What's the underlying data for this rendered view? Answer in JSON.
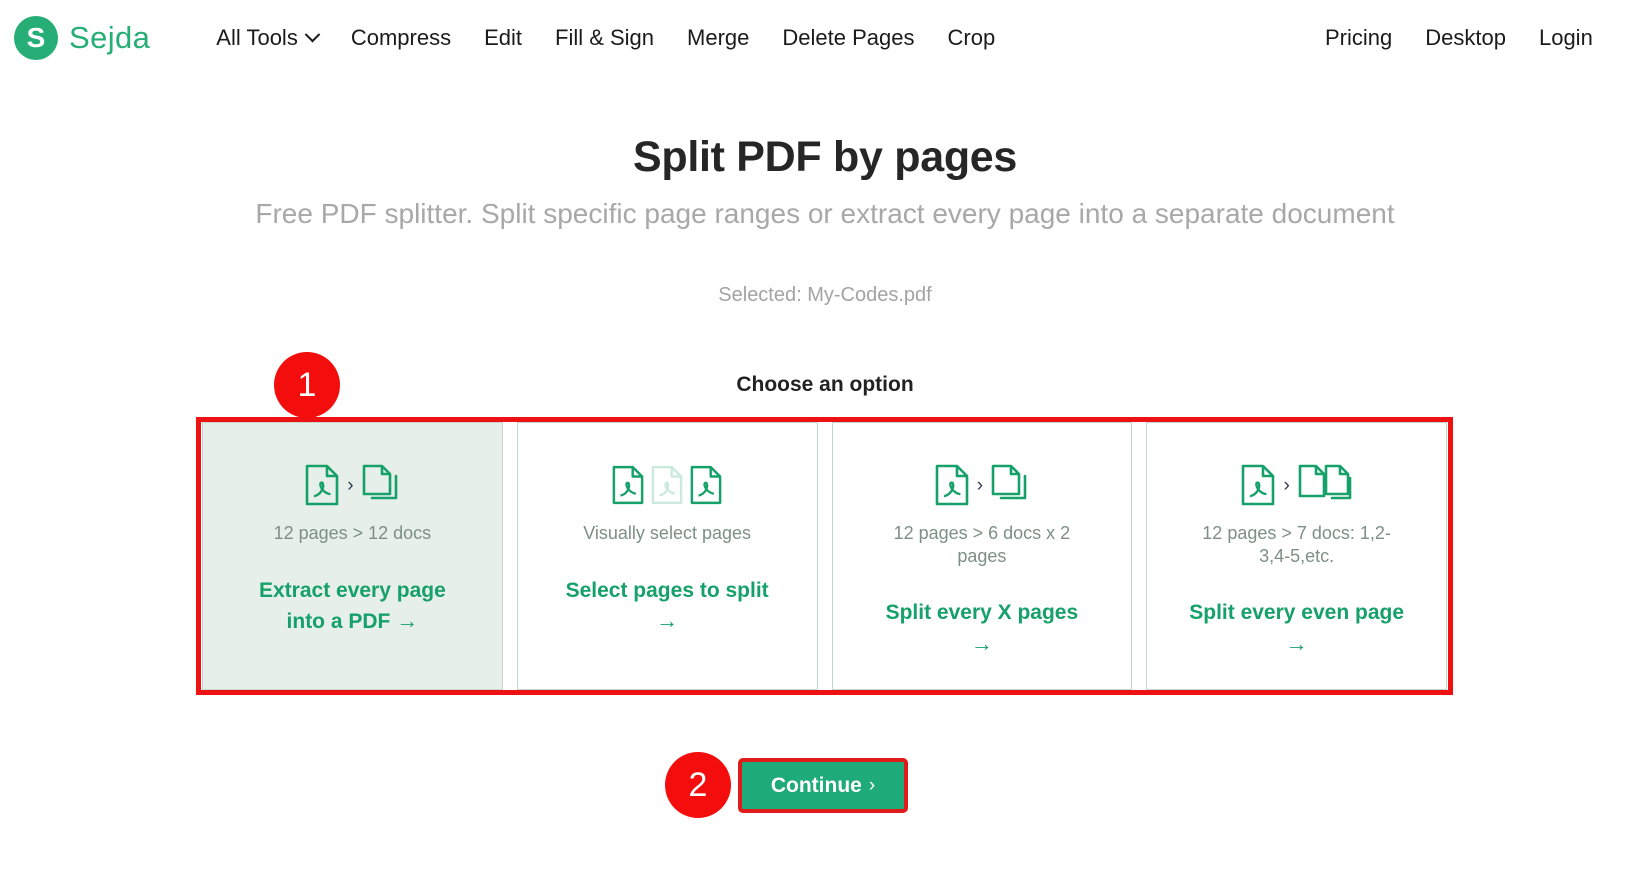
{
  "nav": {
    "brand": {
      "logo_letter": "S",
      "name": "Sejda"
    },
    "left_items": [
      {
        "label": "All Tools",
        "has_dropdown": true
      },
      {
        "label": "Compress",
        "has_dropdown": false
      },
      {
        "label": "Edit",
        "has_dropdown": false
      },
      {
        "label": "Fill & Sign",
        "has_dropdown": false
      },
      {
        "label": "Merge",
        "has_dropdown": false
      },
      {
        "label": "Delete Pages",
        "has_dropdown": false
      },
      {
        "label": "Crop",
        "has_dropdown": false
      }
    ],
    "right_items": [
      {
        "label": "Pricing"
      },
      {
        "label": "Desktop"
      },
      {
        "label": "Login"
      }
    ]
  },
  "page": {
    "title": "Split PDF by pages",
    "subtitle": "Free PDF splitter. Split specific page ranges or extract every page into a separate document",
    "selected_file": "Selected: My-Codes.pdf",
    "choose_option_heading": "Choose an option"
  },
  "options": [
    {
      "id": "extract-every-page",
      "summary": "12 pages > 12 docs",
      "title": "Extract every page into a PDF",
      "arrow": "→",
      "selected": true,
      "icons": [
        "pdf-file-icon",
        "chevron-right-icon",
        "copy-docs-icon"
      ]
    },
    {
      "id": "select-pages-to-split",
      "summary": "Visually select pages",
      "title": "Select pages to split",
      "arrow": "→",
      "selected": false,
      "icons": [
        "pdf-file-icon",
        "pdf-file-faded-icon",
        "pdf-file-icon"
      ]
    },
    {
      "id": "split-every-x-pages",
      "summary": "12 pages > 6 docs x 2 pages",
      "title": "Split every X pages",
      "arrow": "→",
      "selected": false,
      "icons": [
        "pdf-file-icon",
        "chevron-right-icon",
        "copy-docs-icon"
      ]
    },
    {
      "id": "split-every-even-page",
      "summary": "12 pages > 7 docs: 1,2-3,4-5,etc.",
      "title": "Split every even page",
      "arrow": "→",
      "selected": false,
      "icons": [
        "pdf-file-icon",
        "chevron-right-icon",
        "two-docs-icon"
      ]
    }
  ],
  "continue": {
    "label": "Continue",
    "chevron": "›"
  },
  "annotations": {
    "badge_1": "1",
    "badge_2": "2",
    "highlight_color": "#ee1111"
  },
  "colors": {
    "brand_green": "#27ae76",
    "title_green": "#16a06a",
    "button_green": "#1eaa79",
    "annotation_red": "#f40d0d",
    "muted_text": "#a8a8a8"
  }
}
